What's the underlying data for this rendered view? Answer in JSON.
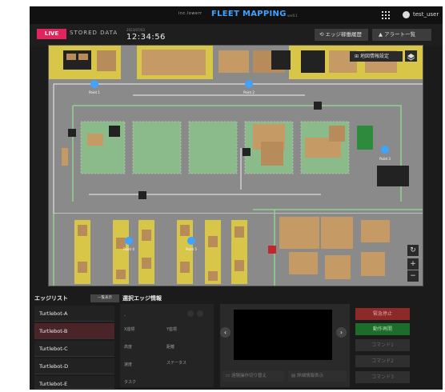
{
  "header": {
    "brand": "inc.lowerr",
    "title": "FLEET MAPPING",
    "version": "ver0.1",
    "user": "test_user"
  },
  "subheader": {
    "live": "LIVE",
    "stored": "STORED DATA",
    "date": "2023/07/03",
    "time": "12:34:56",
    "edge_history": "エッジ稼働履歴",
    "alert_list": "アラート一覧"
  },
  "map": {
    "info_button": "地図情報設定",
    "pins": [
      "Point 1",
      "Point 2",
      "Point 3",
      "Point 4",
      "Point 5"
    ]
  },
  "edge_list": {
    "title": "エッジリスト",
    "list_all": "一覧表示",
    "items": [
      "Turtlebot-A",
      "Turtlebot-B",
      "Turtlebot-C",
      "Turtlebot-D",
      "Turtlebot-E"
    ],
    "selected_index": 1
  },
  "selected_edge": {
    "title": "選択エッジ情報",
    "dash": "-",
    "labels": {
      "x": "X座標",
      "y": "Y座標",
      "altitude": "高度",
      "direction": "距離",
      "speed": "速度",
      "status": "ステータス",
      "task": "タスク"
    }
  },
  "camera": {
    "remote_switch": "遠隔操作切り替え",
    "detail_display": "詳細情報表示"
  },
  "commands": {
    "emergency_stop": "緊急停止",
    "resume": "動作再開",
    "command1": "コマンド1",
    "command2": "コマンド2",
    "command3": "コマンド3"
  },
  "colors": {
    "accent_blue": "#3fa3ff",
    "live_pink": "#e0245e",
    "stop_red": "#8c2a2a",
    "resume_green": "#1f6b2c",
    "shelf_yellow": "#d6c34a",
    "zone_green": "#7fbf7f"
  }
}
